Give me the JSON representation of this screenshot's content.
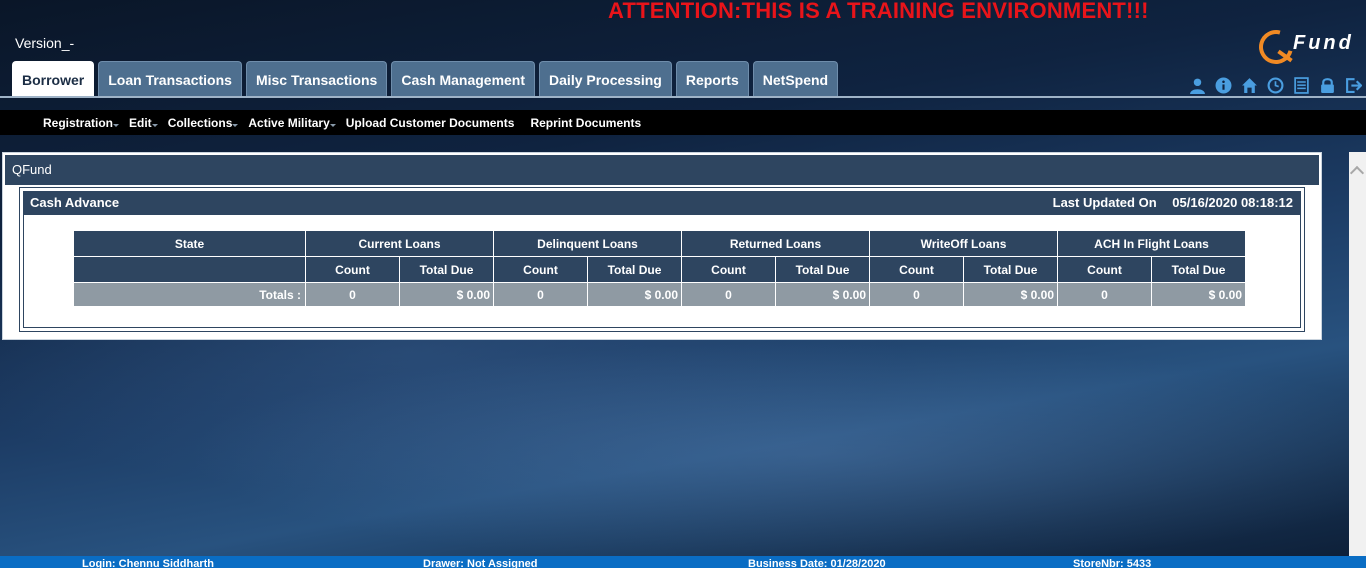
{
  "banner": "ATTENTION:THIS IS A TRAINING ENVIRONMENT!!!",
  "version": "Version_-",
  "logo": {
    "text": "Fund",
    "accent": "#f08a24"
  },
  "tabs": [
    {
      "label": "Borrower",
      "active": true
    },
    {
      "label": "Loan Transactions"
    },
    {
      "label": "Misc Transactions"
    },
    {
      "label": "Cash Management"
    },
    {
      "label": "Daily Processing"
    },
    {
      "label": "Reports"
    },
    {
      "label": "NetSpend"
    }
  ],
  "toolbar_icons": [
    "user-icon",
    "info-icon",
    "home-icon",
    "clock-icon",
    "list-icon",
    "lock-icon",
    "logout-icon"
  ],
  "submenu": [
    {
      "label": "Registration",
      "dropdown": true
    },
    {
      "label": "Edit",
      "dropdown": true
    },
    {
      "label": "Collections",
      "dropdown": true
    },
    {
      "label": "Active Military",
      "dropdown": true
    },
    {
      "label": "Upload Customer Documents",
      "dropdown": false
    },
    {
      "label": "Reprint Documents",
      "dropdown": false
    }
  ],
  "panel": {
    "title": "QFund",
    "section_title": "Cash Advance",
    "last_updated_label": "Last Updated On",
    "last_updated_value": "05/16/2020 08:18:12"
  },
  "table": {
    "state_header": "State",
    "groups": [
      "Current Loans",
      "Delinquent Loans",
      "Returned Loans",
      "WriteOff Loans",
      "ACH In Flight Loans"
    ],
    "count_label": "Count",
    "total_due_label": "Total Due",
    "totals_label": "Totals :",
    "totals": [
      {
        "count": "0",
        "total_due": "$ 0.00"
      },
      {
        "count": "0",
        "total_due": "$ 0.00"
      },
      {
        "count": "0",
        "total_due": "$ 0.00"
      },
      {
        "count": "0",
        "total_due": "$ 0.00"
      },
      {
        "count": "0",
        "total_due": "$ 0.00"
      }
    ]
  },
  "footer": {
    "login": "Login: Chennu Siddharth",
    "drawer": "Drawer: Not Assigned",
    "business_date": "Business Date: 01/28/2020",
    "store": "StoreNbr: 5433"
  },
  "colors": {
    "banner": "#e8141a",
    "header_bg": "#2e4560",
    "tab_bg": "#4e6f8f",
    "footer_bg": "#0a6dc4",
    "icon": "#4a9ee0"
  }
}
